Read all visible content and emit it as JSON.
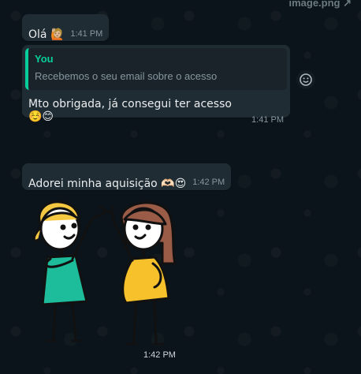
{
  "header": {
    "label": "image.png ↗"
  },
  "messages": [
    {
      "text": "Olá 🙋🏼",
      "time": "1:41 PM"
    },
    {
      "quote_author": "You",
      "quote_text": "Recebemos o seu email sobre o acesso",
      "text": "Mto obrigada,  já consegui ter acesso ☺️😊",
      "time": "1:41 PM"
    },
    {
      "text": "Adorei minha aquisição 🫶🏻😍",
      "time": "1:42 PM"
    },
    {
      "sticker": "high-five-girls",
      "time": "1:42 PM"
    }
  ],
  "colors": {
    "bubble": "#202c33",
    "quote_accent": "#06cf9c",
    "background": "#0b141a"
  },
  "icons": {
    "react": "emoji-reaction-icon"
  }
}
